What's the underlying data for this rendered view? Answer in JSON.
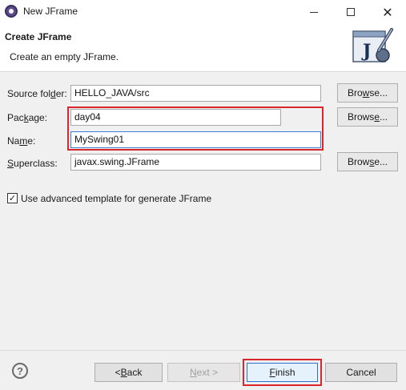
{
  "window": {
    "title": "New JFrame",
    "minimize_icon": "minimize-icon",
    "maximize_icon": "maximize-icon",
    "close_glyph": "✕"
  },
  "banner": {
    "title": "Create JFrame",
    "subtitle": "Create an empty JFrame.",
    "graphic_letter": "J"
  },
  "form": {
    "source_folder": {
      "label_pre": "Source fol",
      "label_mnemonic": "d",
      "label_post": "er:",
      "value": "HELLO_JAVA/src"
    },
    "package": {
      "label_pre": "Pac",
      "label_mnemonic": "k",
      "label_post": "age:",
      "value": "day04"
    },
    "name": {
      "label_pre": "Na",
      "label_mnemonic": "m",
      "label_post": "e:",
      "value": "MySwing01"
    },
    "superclass": {
      "label_pre": "",
      "label_mnemonic": "S",
      "label_post": "uperclass:",
      "value": "javax.swing.JFrame"
    },
    "browse_pre": "Bro",
    "browse_mnemonic": "w",
    "browse_post": "se...",
    "browse_pre_3": "Brow",
    "browse_mnemonic_3": "s",
    "browse_post_3": "e...",
    "browse_pre_4": "Brows",
    "browse_mnemonic_4": "e",
    "browse_post_4": "...",
    "advanced_template": {
      "checked": true,
      "check_glyph": "✓",
      "label": "Use advanced template for generate JFrame"
    }
  },
  "footer": {
    "help_glyph": "?",
    "back": {
      "pre": "< ",
      "mnemonic": "B",
      "post": "ack"
    },
    "next": {
      "pre": "",
      "mnemonic": "N",
      "post": "ext >"
    },
    "finish": {
      "pre": "",
      "mnemonic": "F",
      "post": "inish"
    },
    "cancel": "Cancel"
  },
  "colors": {
    "highlight": "#d9262c",
    "focus": "#3d7ad6",
    "default_button": "#2f6fd0"
  }
}
